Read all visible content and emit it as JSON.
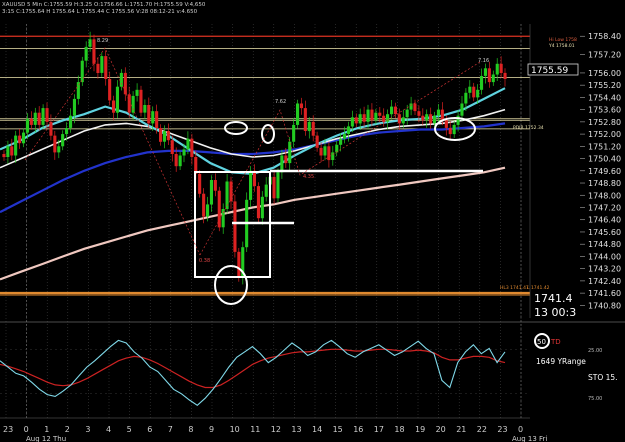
{
  "header": {
    "symbol_line": "XAUUSD 5 Min C:1755.59 H:3.25 O:1756.66 L:1751.70 H:1755.59 V:4,650",
    "ohlc_line": "3:15 C:1755.64 H 1755.64 L 1755.44 C 1755.56 V:28 08:12-21 v:4.650"
  },
  "price_box": {
    "current": "1755.59",
    "last_big": "1741.4",
    "time": "13 00:3"
  },
  "level_labels": {
    "hi_low": "Hi Low 1758",
    "y4": "Y4 1758.01",
    "pdir": "PDIR 1752.34",
    "hl3": "HL3 1741.47",
    "hl3_b": "L 1741.42"
  },
  "annotations": [
    "8.29",
    "7.62",
    "7.16",
    "4.35",
    "0.38"
  ],
  "indicator": {
    "badge": "50",
    "td": "TD",
    "yrange": "1649 YRange",
    "sto": "STO 15.",
    "scale_top": "25.00",
    "scale_bottom": "75.00"
  },
  "colors": {
    "background": "#000000",
    "candle_up": "#22cc22",
    "candle_down": "#dd2222",
    "ema_cyan": "#5fd3e0",
    "ema_white": "#f2f2f2",
    "ema_blue": "#2233cc",
    "ema_pink": "#f0c8c0",
    "level_red": "#dd3322",
    "level_orange": "#e08a30",
    "level_cream": "#f1e8b0",
    "stoch_cyan": "#7fd8e8",
    "stoch_red": "#cc2222"
  },
  "chart_data": {
    "type": "candlestick",
    "y_axis": {
      "ticks": [
        "1758.40",
        "1757.20",
        "1756.00",
        "1755.20",
        "1754.40",
        "1753.60",
        "1752.80",
        "1752.00",
        "1751.20",
        "1750.40",
        "1749.60",
        "1748.80",
        "1748.00",
        "1747.20",
        "1746.40",
        "1745.60",
        "1744.80",
        "1744.00",
        "1743.20",
        "1742.40",
        "1741.60",
        "1740.80"
      ],
      "ylim": [
        1740.3,
        1759.2
      ]
    },
    "x_axis": {
      "ticks": [
        "23",
        "0",
        "1",
        "2",
        "3",
        "4",
        "5",
        "6",
        "7",
        "8",
        "9",
        "10",
        "11",
        "12",
        "13",
        "14",
        "15",
        "16",
        "17",
        "18",
        "19",
        "20",
        "21",
        "22",
        "23",
        "0"
      ],
      "dates": [
        "Aug 12 Thu",
        "Aug 13 Fri"
      ]
    },
    "levels": [
      1758.4,
      1757.6,
      1755.7,
      1753.0,
      1752.9,
      1752.34,
      1741.6,
      1741.47
    ],
    "ohlc_path": [
      1750.7,
      1750.5,
      1751.2,
      1750.6,
      1751.9,
      1751.4,
      1752.1,
      1753.0,
      1752.6,
      1753.4,
      1752.6,
      1753.7,
      1752.8,
      1751.9,
      1750.8,
      1751.2,
      1752.0,
      1752.4,
      1753.2,
      1754.3,
      1755.4,
      1756.8,
      1757.7,
      1758.2,
      1756.6,
      1756.0,
      1757.1,
      1755.6,
      1754.2,
      1753.4,
      1755.1,
      1756.0,
      1754.6,
      1753.4,
      1754.5,
      1754.9,
      1753.4,
      1753.9,
      1752.7,
      1753.5,
      1752.4,
      1751.5,
      1752.2,
      1751.6,
      1750.7,
      1749.9,
      1750.6,
      1751.0,
      1751.7,
      1750.5,
      1749.4,
      1748.1,
      1746.6,
      1747.4,
      1749.0,
      1748.3,
      1745.9,
      1747.1,
      1748.9,
      1747.6,
      1744.3,
      1742.6,
      1744.6,
      1747.7,
      1749.6,
      1748.6,
      1746.5,
      1747.9,
      1748.7,
      1749.2,
      1747.8,
      1749.5,
      1750.6,
      1750.1,
      1751.5,
      1752.6,
      1754.0,
      1753.7,
      1752.2,
      1752.8,
      1751.9,
      1751.1,
      1750.6,
      1751.2,
      1750.3,
      1750.8,
      1751.3,
      1751.7,
      1752.0,
      1752.5,
      1753.1,
      1752.7,
      1753.3,
      1752.8,
      1753.6,
      1752.9,
      1753.4,
      1753.2,
      1752.8,
      1753.3,
      1753.8,
      1753.3,
      1752.7,
      1753.1,
      1753.6,
      1754.0,
      1753.5,
      1753.2,
      1752.9,
      1753.3,
      1752.7,
      1753.2,
      1753.6,
      1752.9,
      1752.4,
      1752.0,
      1752.6,
      1753.2,
      1754.0,
      1754.7,
      1755.1,
      1754.4,
      1754.9,
      1755.8,
      1756.3,
      1755.4,
      1755.9,
      1756.6,
      1756.0,
      1755.6
    ],
    "ema_cyan": [
      1751.0,
      1751.6,
      1752.4,
      1752.9,
      1753.3,
      1753.8,
      1753.4,
      1752.6,
      1751.9,
      1751.0,
      1750.1,
      1749.5,
      1749.4,
      1749.8,
      1750.6,
      1751.3,
      1751.9,
      1752.4,
      1752.7,
      1752.9,
      1753.0,
      1753.2,
      1753.6,
      1754.3,
      1755.0
    ],
    "ema_white": [
      1749.8,
      1750.4,
      1751.0,
      1751.6,
      1752.2,
      1752.6,
      1752.7,
      1752.5,
      1752.1,
      1751.6,
      1751.1,
      1750.7,
      1750.5,
      1750.6,
      1750.9,
      1751.3,
      1751.7,
      1752.0,
      1752.3,
      1752.5,
      1752.6,
      1752.7,
      1752.9,
      1753.2,
      1753.6
    ],
    "ema_blue": [
      1746.9,
      1747.6,
      1748.3,
      1749.0,
      1749.6,
      1750.1,
      1750.5,
      1750.8,
      1750.9,
      1750.9,
      1750.8,
      1750.7,
      1750.7,
      1750.8,
      1751.0,
      1751.3,
      1751.6,
      1751.9,
      1752.1,
      1752.2,
      1752.3,
      1752.3,
      1752.4,
      1752.5,
      1752.7
    ],
    "ema_pink": [
      1742.5,
      1743.0,
      1743.5,
      1744.0,
      1744.5,
      1744.9,
      1745.3,
      1745.7,
      1746.0,
      1746.3,
      1746.6,
      1746.9,
      1747.2,
      1747.4,
      1747.7,
      1747.9,
      1748.1,
      1748.3,
      1748.5,
      1748.7,
      1748.9,
      1749.1,
      1749.3,
      1749.5,
      1749.8
    ],
    "stoch_range": [
      0,
      100
    ],
    "stoch_cyan": [
      62,
      55,
      48,
      45,
      38,
      30,
      24,
      22,
      28,
      35,
      45,
      55,
      62,
      70,
      78,
      85,
      82,
      72,
      65,
      55,
      50,
      40,
      30,
      25,
      18,
      12,
      20,
      30,
      42,
      55,
      66,
      72,
      78,
      70,
      60,
      66,
      74,
      82,
      76,
      68,
      72,
      80,
      85,
      78,
      70,
      66,
      72,
      76,
      80,
      74,
      68,
      72,
      78,
      84,
      76,
      70,
      40,
      32,
      60,
      72,
      80,
      70,
      76,
      60,
      72
    ],
    "stoch_red": [
      58,
      56,
      53,
      50,
      46,
      42,
      38,
      35,
      34,
      35,
      38,
      42,
      47,
      52,
      57,
      62,
      65,
      67,
      66,
      63,
      59,
      54,
      49,
      44,
      39,
      35,
      32,
      32,
      35,
      40,
      46,
      52,
      58,
      62,
      65,
      67,
      69,
      71,
      72,
      72,
      73,
      74,
      75,
      75,
      74,
      73,
      73,
      74,
      75,
      75,
      74,
      73,
      73,
      74,
      73,
      71,
      66,
      63,
      63,
      65,
      67,
      67,
      66,
      62,
      60
    ]
  }
}
